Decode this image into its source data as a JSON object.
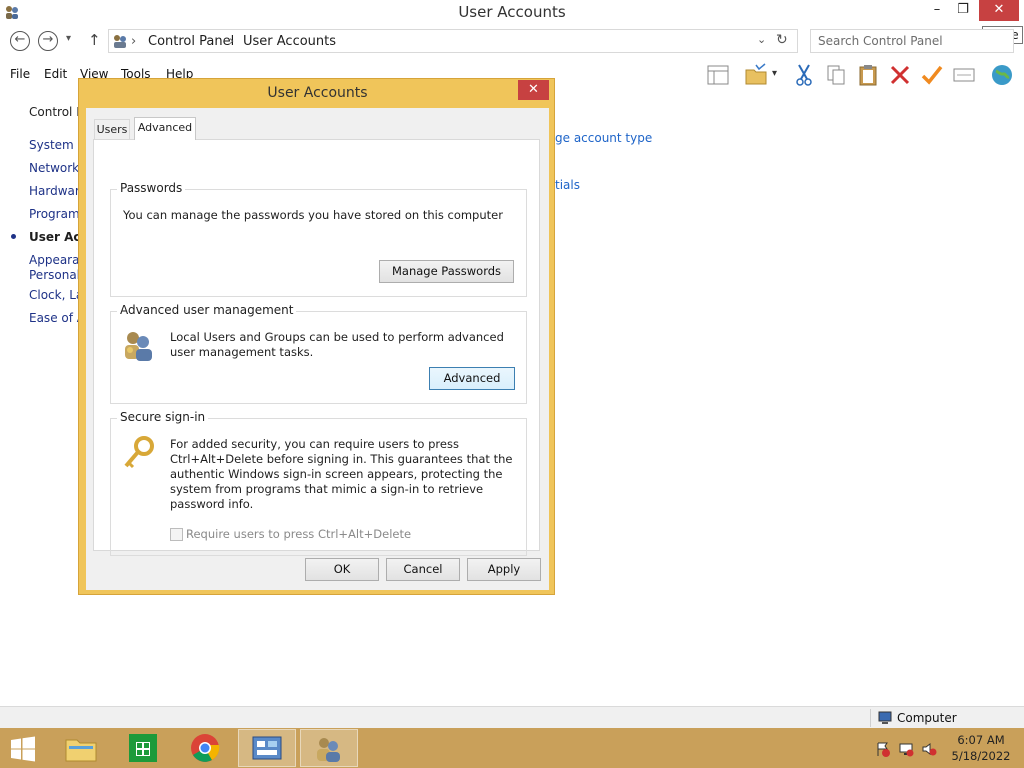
{
  "window": {
    "title": "User Accounts",
    "minimize": "–",
    "restore": "❐",
    "close": "✕",
    "close_tooltip": "Close"
  },
  "address": {
    "segments": [
      "Control Panel",
      "User Accounts"
    ],
    "separator": "›",
    "search_placeholder": "Search Control Panel"
  },
  "menu": [
    "File",
    "Edit",
    "View",
    "Tools",
    "Help"
  ],
  "left_nav": {
    "items": [
      "Control P",
      "System ar",
      "Network",
      "Hardware",
      "Programs",
      "User Accc",
      "Appearan",
      "Personaliz",
      "Clock, La",
      "Ease of A"
    ],
    "active_index": 5
  },
  "background_links": {
    "change_type": "ge account type",
    "credentials": "tials"
  },
  "dialog": {
    "title": "User Accounts",
    "close": "✕",
    "tabs": [
      "Users",
      "Advanced"
    ],
    "active_tab": "Advanced",
    "passwords": {
      "label": "Passwords",
      "text": "You can manage the passwords you have stored on this computer",
      "button": "Manage Passwords"
    },
    "advanced_mgmt": {
      "label": "Advanced user management",
      "text": "Local Users and Groups can be used to perform advanced user management tasks.",
      "button": "Advanced"
    },
    "secure_signin": {
      "label": "Secure sign-in",
      "text": "For added security, you can require users to press Ctrl+Alt+Delete before signing in. This guarantees that the authentic Windows sign-in screen appears, protecting the system from programs that mimic a sign-in to retrieve password info.",
      "checkbox_label": "Require users to press Ctrl+Alt+Delete",
      "checkbox_checked": false
    },
    "buttons": {
      "ok": "OK",
      "cancel": "Cancel",
      "apply": "Apply"
    }
  },
  "status": {
    "computer": "Computer"
  },
  "taskbar": {
    "time": "6:07 AM",
    "date": "5/18/2022"
  },
  "colors": {
    "dialog_frame": "#f0c55a",
    "close_red": "#c74141",
    "taskbar": "#c9a05a",
    "link_blue": "#1e3287"
  }
}
